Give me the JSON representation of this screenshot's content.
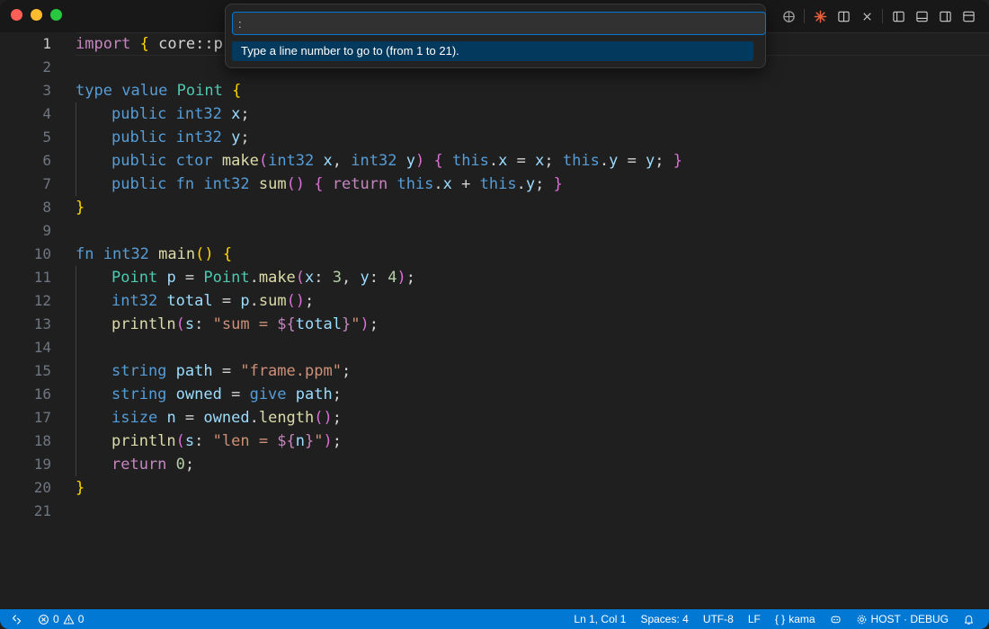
{
  "titlebar": {
    "icons": [
      "copilot-icon",
      "sparkle-icon",
      "split-editor-icon",
      "close-icon",
      "toggle-primary-sidebar-icon",
      "toggle-panel-icon",
      "toggle-secondary-sidebar-icon",
      "customize-layout-icon"
    ]
  },
  "quick_open": {
    "value": ":",
    "hint": "Type a line number to go to (from 1 to 21)."
  },
  "editor": {
    "line_numbers": [
      "1",
      "2",
      "3",
      "4",
      "5",
      "6",
      "7",
      "8",
      "9",
      "10",
      "11",
      "12",
      "13",
      "14",
      "15",
      "16",
      "17",
      "18",
      "19",
      "20",
      "21"
    ],
    "active_line": 1,
    "tokens": {
      "l1_import": "import",
      "l1_brace": "{",
      "l1_rest": " core::pr",
      "l3_type": "type",
      "l3_value": "value",
      "l3_name": "Point",
      "l3_brace": "{",
      "l4_public": "public",
      "l4_type": "int32",
      "l4_var": "x",
      "l4_semi": ";",
      "l5_public": "public",
      "l5_type": "int32",
      "l5_var": "y",
      "l5_semi": ";",
      "l6_public": "public",
      "l6_ctor": "ctor",
      "l6_fn": "make",
      "l6_p1": "(",
      "l6_t1": "int32",
      "l6_v1": "x",
      "l6_comma": ",",
      "l6_t2": "int32",
      "l6_v2": "y",
      "l6_p2": ")",
      "l6_b1": "{",
      "l6_this1": "this",
      "l6_dotx": ".",
      "l6_x1": "x",
      "l6_eq1": " = ",
      "l6_x2": "x",
      "l6_semi1": ";",
      "l6_this2": "this",
      "l6_doty": ".",
      "l6_y1": "y",
      "l6_eq2": " = ",
      "l6_y2": "y",
      "l6_semi2": ";",
      "l6_b2": "}",
      "l7_public": "public",
      "l7_fnkw": "fn",
      "l7_type": "int32",
      "l7_fn": "sum",
      "l7_parens": "()",
      "l7_b1": "{",
      "l7_return": "return",
      "l7_this1": "this",
      "l7_dot1": ".",
      "l7_x": "x",
      "l7_plus": " + ",
      "l7_this2": "this",
      "l7_dot2": ".",
      "l7_y": "y",
      "l7_semi": ";",
      "l7_b2": "}",
      "l8_brace": "}",
      "l10_fn": "fn",
      "l10_type": "int32",
      "l10_name": "main",
      "l10_parens": "()",
      "l10_brace": "{",
      "l11_type": "Point",
      "l11_var": "p",
      "l11_eq": " = ",
      "l11_type2": "Point",
      "l11_dot": ".",
      "l11_fn": "make",
      "l11_p1": "(",
      "l11_a1": "x",
      "l11_c1": ": ",
      "l11_n1": "3",
      "l11_comma": ", ",
      "l11_a2": "y",
      "l11_c2": ": ",
      "l11_n2": "4",
      "l11_p2": ")",
      "l11_semi": ";",
      "l12_type": "int32",
      "l12_var": "total",
      "l12_eq": " = ",
      "l12_p": "p",
      "l12_dot": ".",
      "l12_fn": "sum",
      "l12_parens": "()",
      "l12_semi": ";",
      "l13_fn": "println",
      "l13_p1": "(",
      "l13_arg": "s",
      "l13_colon": ": ",
      "l13_str1": "\"sum = ",
      "l13_interp_open": "${",
      "l13_var": "total",
      "l13_interp_close": "}",
      "l13_str2": "\"",
      "l13_p2": ")",
      "l13_semi": ";",
      "l15_type": "string",
      "l15_var": "path",
      "l15_eq": " = ",
      "l15_str": "\"frame.ppm\"",
      "l15_semi": ";",
      "l16_type": "string",
      "l16_var": "owned",
      "l16_eq": " = ",
      "l16_give": "give",
      "l16_path": "path",
      "l16_semi": ";",
      "l17_type": "isize",
      "l17_var": "n",
      "l17_eq": " = ",
      "l17_owned": "owned",
      "l17_dot": ".",
      "l17_fn": "length",
      "l17_parens": "()",
      "l17_semi": ";",
      "l18_fn": "println",
      "l18_p1": "(",
      "l18_arg": "s",
      "l18_colon": ": ",
      "l18_str1": "\"len = ",
      "l18_interp_open": "${",
      "l18_var": "n",
      "l18_interp_close": "}",
      "l18_str2": "\"",
      "l18_p2": ")",
      "l18_semi": ";",
      "l19_return": "return",
      "l19_num": "0",
      "l19_semi": ";",
      "l20_brace": "}"
    }
  },
  "statusbar": {
    "errors": "0",
    "warnings": "0",
    "position": "Ln 1, Col 1",
    "spaces": "Spaces: 4",
    "encoding": "UTF-8",
    "eol": "LF",
    "language": "kama",
    "host": "HOST · DEBUG"
  },
  "colors": {
    "statusbar_bg": "#0078d4",
    "editor_bg": "#1f1f1f",
    "keyword": "#569cd6",
    "type": "#4ec9b0",
    "function": "#dcdcaa",
    "variable": "#9cdcfe",
    "string": "#ce9178",
    "control": "#c586c0"
  }
}
